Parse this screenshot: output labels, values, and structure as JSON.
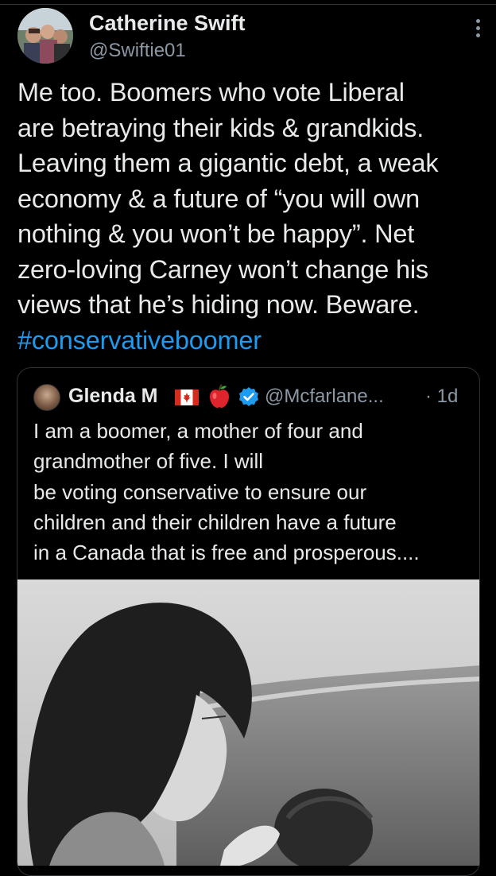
{
  "tweet": {
    "author_name": "Catherine Swift",
    "author_handle": "@Swiftie01",
    "text": "Me too. Boomers who vote Liberal\nare betraying their kids & grandkids.\nLeaving them a gigantic debt, a weak\neconomy & a future of “you will own\nnothing & you won’t be happy”. Net\nzero-loving Carney won’t change his\nviews that he’s hiding now. Beware.",
    "hashtag": "#conservativeboomer"
  },
  "quoted_tweet": {
    "author_name": "Glenda M",
    "author_handle": "@Mcfarlane...",
    "time": "· 1d",
    "text": "I am a boomer, a mother of four and\ngrandmother of five. I will\nbe voting conservative to ensure our\nchildren and their children have a future\nin a Canada that is free and prosperous....",
    "badges": [
      "canada-flag-icon",
      "apple-icon",
      "verified-icon"
    ]
  },
  "colors": {
    "background": "#000000",
    "text": "#e7e9ea",
    "secondary": "#8b98a5",
    "link": "#1d9bf0",
    "border": "#2f3336",
    "verified": "#1d9bf0"
  },
  "icons": {
    "more": "more-options-icon"
  }
}
